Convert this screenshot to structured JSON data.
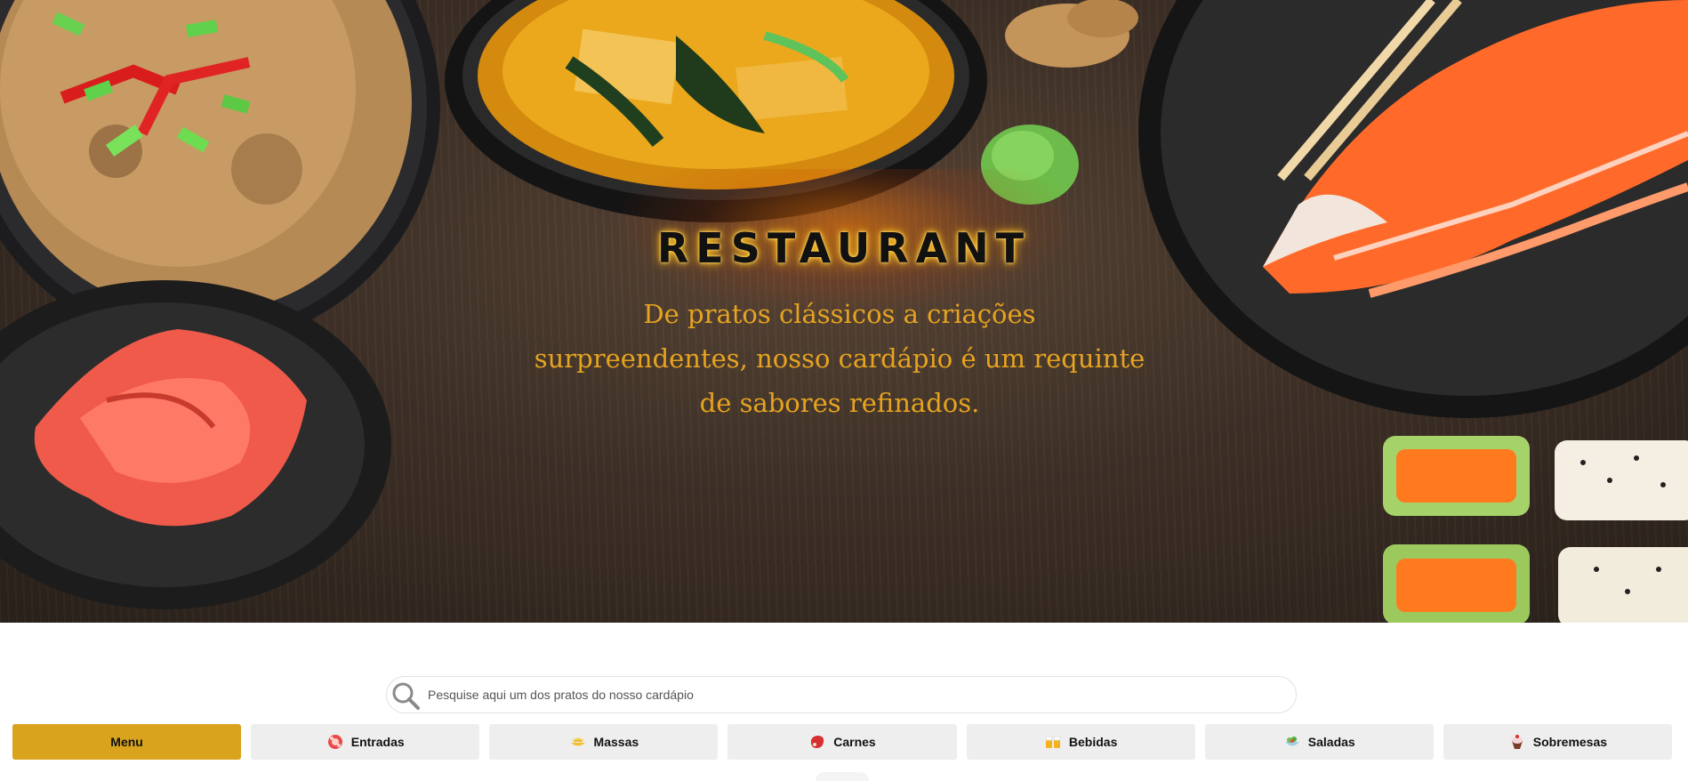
{
  "hero": {
    "title": "RESTAURANT",
    "subtitle": "De pratos clássicos a criações surpreendentes, nosso cardápio é um requinte de sabores refinados."
  },
  "search": {
    "placeholder": "Pesquise aqui um dos pratos do nosso cardápio",
    "value": "",
    "icon": "search-icon"
  },
  "categories": [
    {
      "label": "Menu",
      "icon": "",
      "active": true
    },
    {
      "label": "Entradas",
      "icon": "appetizer-icon",
      "active": false
    },
    {
      "label": "Massas",
      "icon": "pasta-icon",
      "active": false
    },
    {
      "label": "Carnes",
      "icon": "meat-icon",
      "active": false
    },
    {
      "label": "Bebidas",
      "icon": "drinks-icon",
      "active": false
    },
    {
      "label": "Saladas",
      "icon": "salad-icon",
      "active": false
    },
    {
      "label": "Sobremesas",
      "icon": "dessert-icon",
      "active": false
    }
  ],
  "colors": {
    "accent": "#d9a31e",
    "subtitle": "#e6a320",
    "tab_bg": "#eeeeee"
  }
}
